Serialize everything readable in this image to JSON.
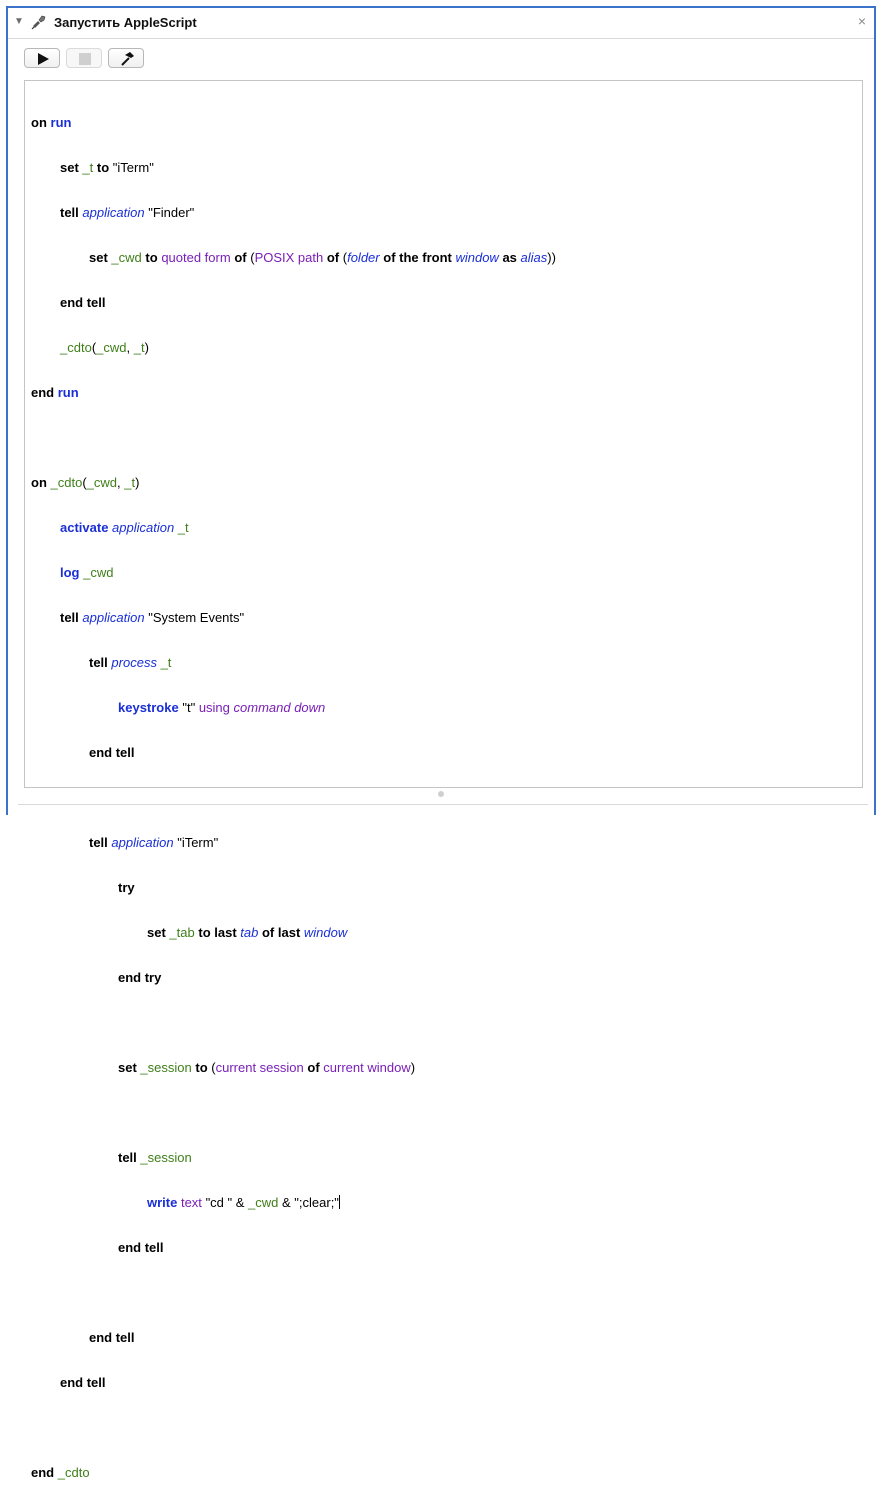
{
  "action": {
    "title": "Запустить AppleScript",
    "disclosure": "▼",
    "close": "×"
  },
  "toolbar": {
    "run_icon": "play-icon",
    "stop_icon": "stop-icon",
    "compile_icon": "hammer-icon"
  },
  "code": {
    "l1": [
      "on",
      "run"
    ],
    "l2": [
      "set",
      "_t",
      "to",
      "\"iTerm\""
    ],
    "l3": [
      "tell",
      "application",
      "\"Finder\""
    ],
    "l4": [
      "set",
      "_cwd",
      "to",
      "quoted form",
      "of",
      "(",
      "POSIX path",
      "of",
      "(",
      "folder",
      "of the front",
      "window",
      "as",
      "alias",
      "))"
    ],
    "l5": [
      "end tell"
    ],
    "l6": [
      "_cdto",
      "(",
      "_cwd",
      ", ",
      "_t",
      ")"
    ],
    "l7": [
      "end",
      "run"
    ],
    "l9": [
      "on",
      "_cdto",
      "(",
      "_cwd",
      ", ",
      "_t",
      ")"
    ],
    "l10": [
      "activate",
      "application",
      "_t"
    ],
    "l11": [
      "log",
      "_cwd"
    ],
    "l12": [
      "tell",
      "application",
      "\"System Events\""
    ],
    "l13": [
      "tell",
      "process",
      "_t"
    ],
    "l14": [
      "keystroke",
      "\"t\"",
      "using",
      "command down"
    ],
    "l15": [
      "end tell"
    ],
    "l17": [
      "tell",
      "application",
      "\"iTerm\""
    ],
    "l18": [
      "try"
    ],
    "l19": [
      "set",
      "_tab",
      "to last",
      "tab",
      "of last",
      "window"
    ],
    "l20": [
      "end try"
    ],
    "l22": [
      "set",
      "_session",
      "to",
      "(",
      "current session",
      "of",
      "current window",
      ")"
    ],
    "l24": [
      "tell",
      "_session"
    ],
    "l25": [
      "write",
      "text",
      "\"cd \" & ",
      "_cwd",
      " & \";clear;\""
    ],
    "l26": [
      "end tell"
    ],
    "l28": [
      "end tell"
    ],
    "l29": [
      "end tell"
    ],
    "l31": [
      "end",
      "_cdto"
    ]
  }
}
